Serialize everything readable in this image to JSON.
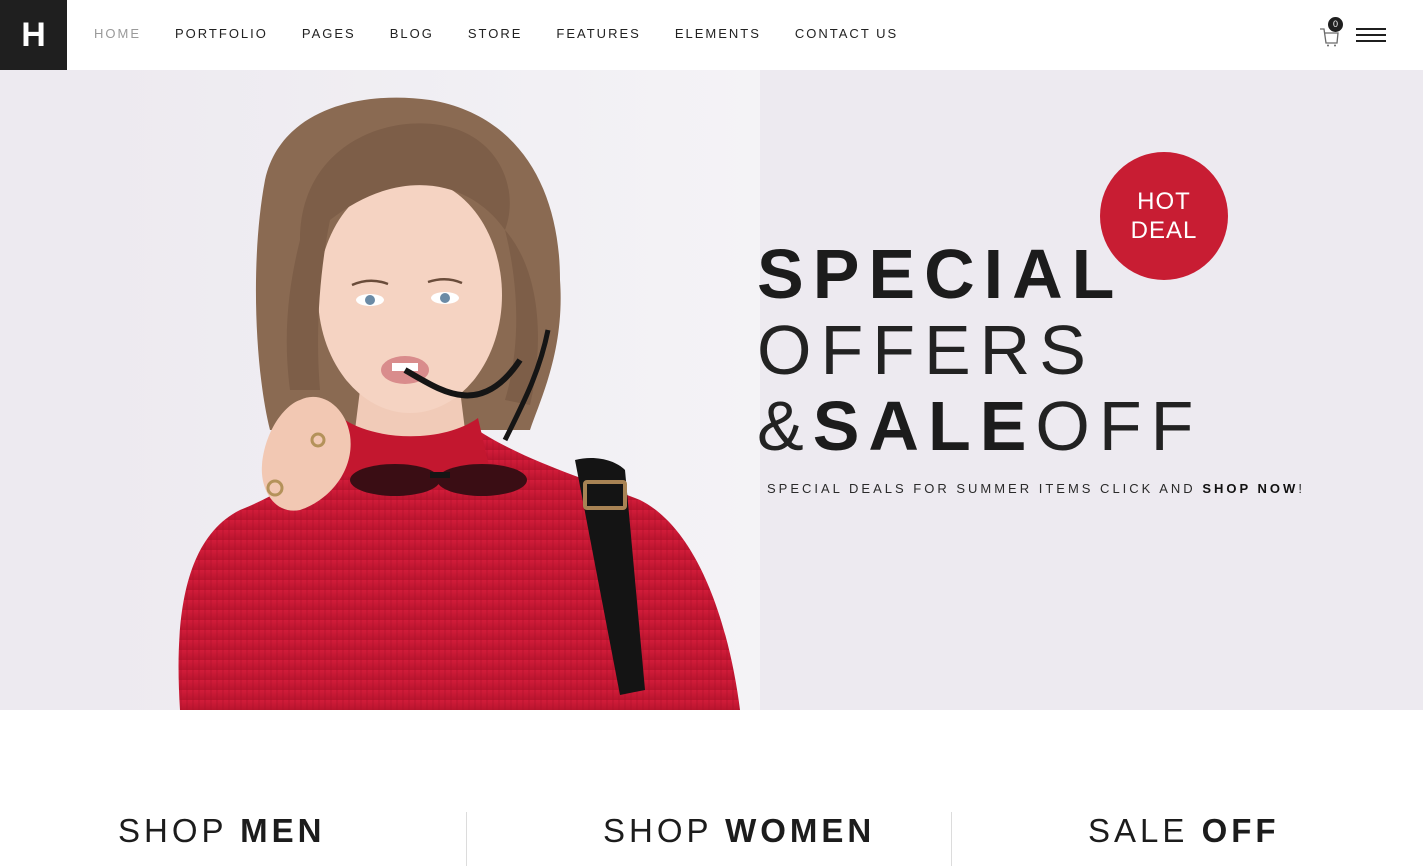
{
  "header": {
    "logo": "H",
    "nav": [
      "HOME",
      "PORTFOLIO",
      "PAGES",
      "BLOG",
      "STORE",
      "FEATURES",
      "ELEMENTS",
      "CONTACT US"
    ],
    "active_nav": "HOME",
    "cart_count": "0"
  },
  "hero": {
    "badge_line1": "HOT",
    "badge_line2": "DEAL",
    "headline_line1": "SPECIAL",
    "headline_line2": "OFFERS",
    "headline_amp": "&",
    "headline_sale": "SALE",
    "headline_off": "OFF",
    "tagline_text": "SPECIAL DEALS FOR SUMMER ITEMS CLICK AND ",
    "tagline_link": "SHOP NOW",
    "tagline_end": "!"
  },
  "categories": [
    {
      "light": "SHOP ",
      "bold": "MEN"
    },
    {
      "light": "SHOP ",
      "bold": "WOMEN"
    },
    {
      "light": "SALE ",
      "bold": "OFF"
    }
  ],
  "colors": {
    "accent": "#c81d33",
    "dark": "#1f1f1f",
    "hero_bg": "#edeaf0"
  },
  "icons": [
    "cart-icon",
    "hamburger-menu-icon"
  ]
}
